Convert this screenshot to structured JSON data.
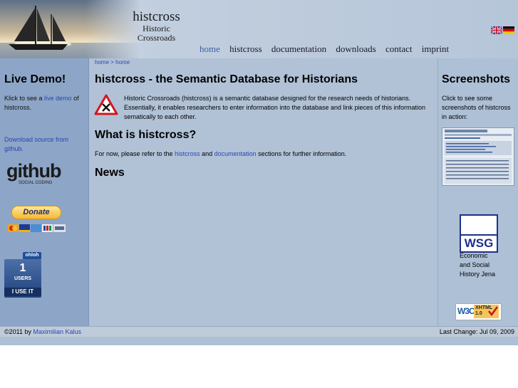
{
  "header": {
    "logo_line1": "histcross",
    "logo_line2": "Historic",
    "logo_line3": "Crossroads",
    "nav": [
      "home",
      "histcross",
      "documentation",
      "downloads",
      "contact",
      "imprint"
    ]
  },
  "breadcrumb": "home > home",
  "left": {
    "title": "Live Demo!",
    "demo_pre": "Klick to see a ",
    "demo_link": "live demo",
    "demo_post": " of histcross.",
    "download_link": "Download source from github.",
    "github_main": "github",
    "github_sub": "SOCIAL CODING",
    "donate": "Donate",
    "ohloh": "ohloh",
    "users_count": "1",
    "users_label": "USERS",
    "iuseit": "I USE IT"
  },
  "main": {
    "title": "histcross - the Semantic Database for Historians",
    "intro": "Historic Crossroads (histcross) is a semantic database designed for the research needs of historians. Essentially, it enables researchers to enter information into the database and link pieces of this information sematically to each other.",
    "what_title": "What is histcross?",
    "what_pre": "For now, please refer to the ",
    "what_link1": "histcross",
    "what_mid": " and ",
    "what_link2": "documentation",
    "what_post": " sections for further information.",
    "news_title": "News"
  },
  "right": {
    "title": "Screenshots",
    "text": "Click to see some screenshots of histcross in action:",
    "wsg": "WSG",
    "wsg_caption1": "Economic",
    "wsg_caption2": "and Social",
    "wsg_caption3": "History Jena",
    "w3c": "W3C",
    "xhtml": "XHTML",
    "xhtml_ver": "1.0"
  },
  "footer": {
    "copyright_pre": "©2011 by ",
    "author": "Maximilian Kalus",
    "last_change": "Last Change: Jul 09, 2009"
  }
}
